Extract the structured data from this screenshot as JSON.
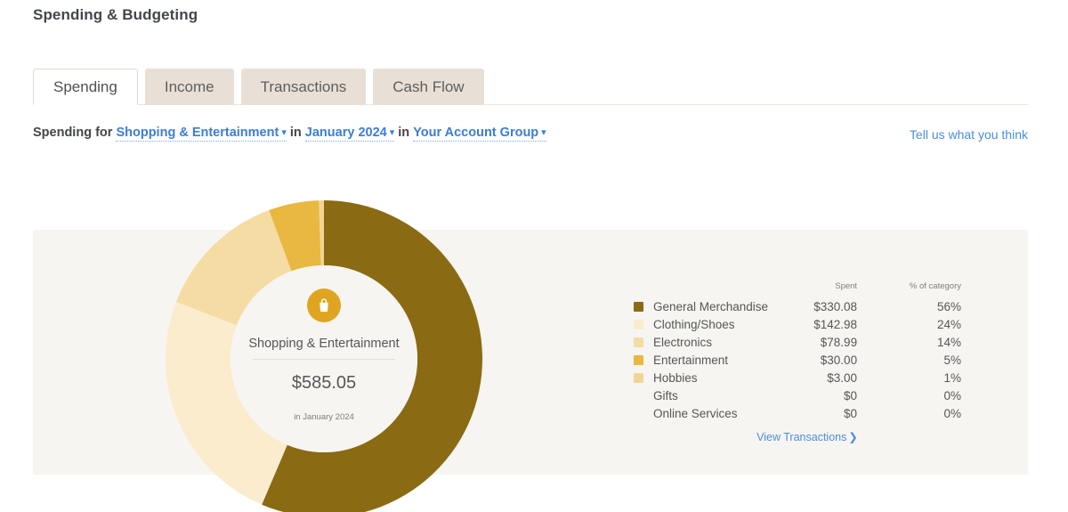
{
  "page": {
    "title": "Spending & Budgeting"
  },
  "tabs": [
    {
      "label": "Spending",
      "active": true
    },
    {
      "label": "Income",
      "active": false
    },
    {
      "label": "Transactions",
      "active": false
    },
    {
      "label": "Cash Flow",
      "active": false
    }
  ],
  "filter": {
    "prefix": "Spending for",
    "category": "Shopping & Entertainment",
    "mid": "in",
    "period": "January 2024",
    "mid2": "in",
    "account_group": "Your Account Group",
    "chevron": "chevron-down-icon"
  },
  "feedback": {
    "label": "Tell us what you think"
  },
  "donut": {
    "icon": "shopping-bag-icon",
    "icon_bg": "#e0a520",
    "category": "Shopping & Entertainment",
    "amount": "$585.05",
    "period": "in January 2024"
  },
  "legend": {
    "headers": {
      "label": "",
      "spent": "Spent",
      "pct": "% of category"
    },
    "rows": [
      {
        "label": "General Merchandise",
        "spent": "$330.08",
        "pct": "56%",
        "color": "#8a6a13",
        "has_swatch": true
      },
      {
        "label": "Clothing/Shoes",
        "spent": "$142.98",
        "pct": "24%",
        "color": "#fbeccd",
        "has_swatch": true
      },
      {
        "label": "Electronics",
        "spent": "$78.99",
        "pct": "14%",
        "color": "#f4dca4",
        "has_swatch": true
      },
      {
        "label": "Entertainment",
        "spent": "$30.00",
        "pct": "5%",
        "color": "#e8b841",
        "has_swatch": true
      },
      {
        "label": "Hobbies",
        "spent": "$3.00",
        "pct": "1%",
        "color": "#f2d595",
        "has_swatch": true
      },
      {
        "label": "Gifts",
        "spent": "$0",
        "pct": "0%",
        "color": "",
        "has_swatch": false
      },
      {
        "label": "Online Services",
        "spent": "$0",
        "pct": "0%",
        "color": "",
        "has_swatch": false
      }
    ]
  },
  "view_transactions": {
    "label": "View Transactions",
    "arrow": "❯"
  },
  "chart_data": {
    "type": "pie",
    "title": "Shopping & Entertainment",
    "subtitle": "in January 2024",
    "total": 585.05,
    "total_label": "$585.05",
    "categories": [
      "General Merchandise",
      "Clothing/Shoes",
      "Electronics",
      "Entertainment",
      "Hobbies",
      "Gifts",
      "Online Services"
    ],
    "values": [
      330.08,
      142.98,
      78.99,
      30.0,
      3.0,
      0,
      0
    ],
    "percents": [
      56,
      24,
      14,
      5,
      1,
      0,
      0
    ],
    "colors": [
      "#8a6a13",
      "#fbeccd",
      "#f4dca4",
      "#e8b841",
      "#f2d595",
      "",
      ""
    ],
    "donut": true,
    "inner_radius_ratio": 0.59,
    "start_angle_deg": 0,
    "direction": "clockwise",
    "legend_position": "right",
    "legend_columns": [
      "Spent",
      "% of category"
    ],
    "grid": false
  },
  "colors": {
    "panel_bg": "#f7f5f1",
    "page_bg": "#ffffff",
    "tab_inactive_bg": "#e8e0d6",
    "link": "#4b8ddf",
    "text": "#55565a",
    "accent": "#e0a520"
  }
}
